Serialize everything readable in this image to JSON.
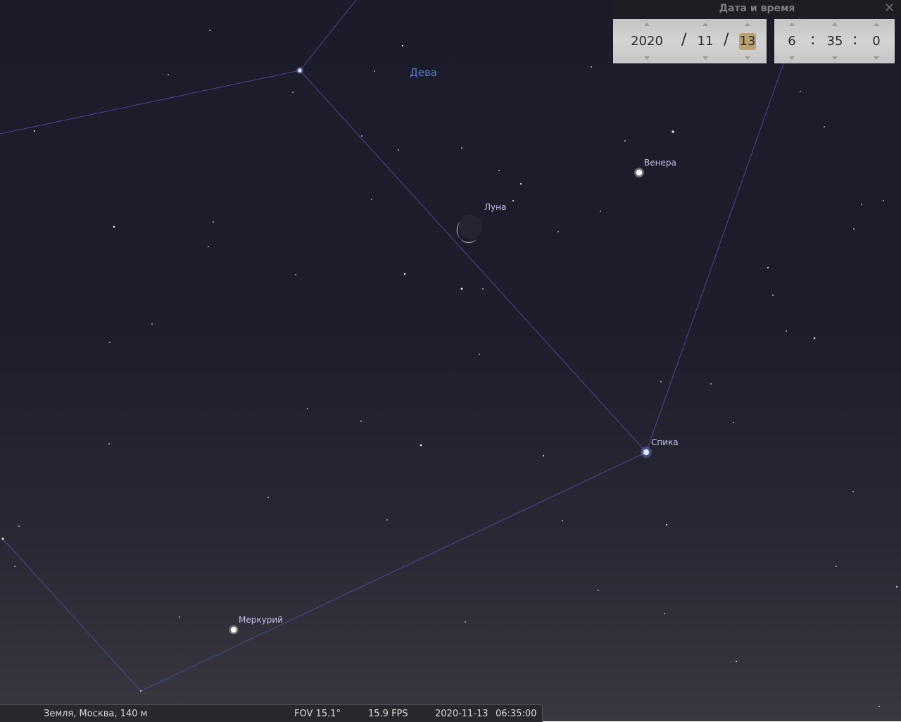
{
  "sky": {
    "constellation_label": "Дева",
    "objects": {
      "venus": "Венера",
      "moon": "Луна",
      "spica": "Спика",
      "mercury": "Меркурий"
    }
  },
  "datetime_dialog": {
    "title": "Дата и время",
    "year": "2020",
    "month": "11",
    "day": "13",
    "hour": "6",
    "minute": "35",
    "second": "0",
    "date_separator": "/",
    "time_separator": ":"
  },
  "statusbar": {
    "location": "Земля, Москва, 140 м",
    "fov": "FOV 15.1°",
    "fps": "15.9 FPS",
    "date": "2020-11-13",
    "time": "06:35:00"
  },
  "colors": {
    "constellation_line": "#4b4b9a",
    "constellation_label": "#5a7bd6",
    "object_label": "#c4c4ee",
    "date_highlight": "#b9a172"
  }
}
